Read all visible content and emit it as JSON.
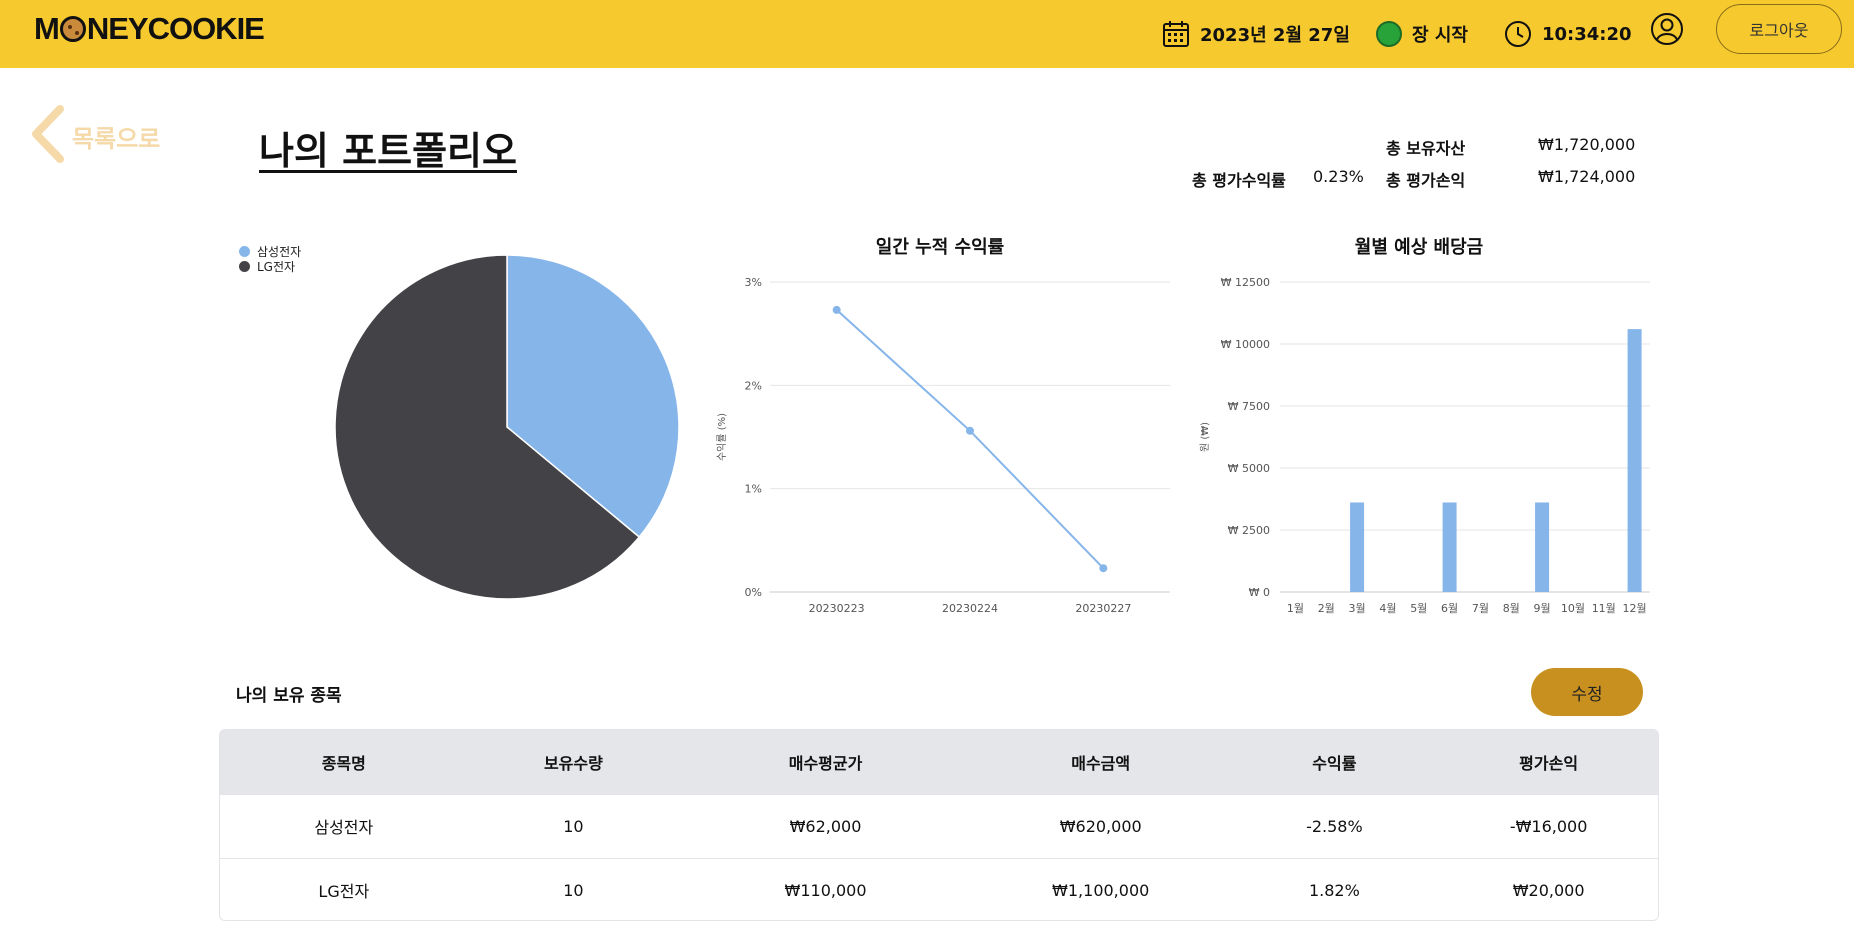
{
  "header": {
    "logo": "MONEYCOOKIE",
    "date": "2023년 2월 27일",
    "market_status": "장 시작",
    "market_status_color": "#28a33a",
    "time": "10:34:20",
    "logout_label": "로그아웃",
    "icons": [
      "calendar-icon",
      "clock-icon",
      "user-icon"
    ]
  },
  "nav": {
    "back_label": "목록으로"
  },
  "page": {
    "title": "나의 포트폴리오"
  },
  "summary": {
    "total_assets_label": "총 보유자산",
    "total_assets_value": "₩1,720,000",
    "return_rate_label": "총 평가수익률",
    "return_rate_value": "0.23%",
    "total_pl_label": "총 평가손익",
    "total_pl_value": "₩1,724,000"
  },
  "chart_data": [
    {
      "type": "pie",
      "title": "",
      "labels": [
        "삼성전자",
        "LG전자"
      ],
      "values": [
        620000,
        1100000
      ],
      "colors": [
        "#86b5ea",
        "#434347"
      ],
      "legend": "top-left"
    },
    {
      "type": "line",
      "title": "일간 누적 수익률",
      "xlabel": "",
      "ylabel": "수익률 (%)",
      "x": [
        "20230223",
        "20230224",
        "20230227"
      ],
      "values": [
        2.73,
        1.56,
        0.23
      ],
      "ylim": [
        0,
        3
      ],
      "yticks": [
        "0%",
        "1%",
        "2%",
        "3%"
      ],
      "color": "#86b5ea",
      "grid": true
    },
    {
      "type": "bar",
      "title": "월별 예상 배당금",
      "xlabel": "",
      "ylabel": "원 (₩)",
      "categories": [
        "1월",
        "2월",
        "3월",
        "4월",
        "5월",
        "6월",
        "7월",
        "8월",
        "9월",
        "10월",
        "11월",
        "12월"
      ],
      "values": [
        0,
        0,
        3610,
        0,
        0,
        3610,
        0,
        0,
        3610,
        0,
        0,
        10600
      ],
      "ylim": [
        0,
        12500
      ],
      "yticks": [
        "₩ 0",
        "₩ 2500",
        "₩ 5000",
        "₩ 7500",
        "₩ 10000",
        "₩ 12500"
      ],
      "color": "#86b5ea",
      "grid": true
    }
  ],
  "holdings": {
    "title": "나의 보유 종목",
    "edit_label": "수정",
    "columns": [
      "종목명",
      "보유수량",
      "매수평균가",
      "매수금액",
      "수익률",
      "평가손익"
    ],
    "rows": [
      [
        "삼성전자",
        "10",
        "₩62,000",
        "₩620,000",
        "-2.58%",
        "-₩16,000"
      ],
      [
        "LG전자",
        "10",
        "₩110,000",
        "₩1,100,000",
        "1.82%",
        "₩20,000"
      ]
    ]
  }
}
